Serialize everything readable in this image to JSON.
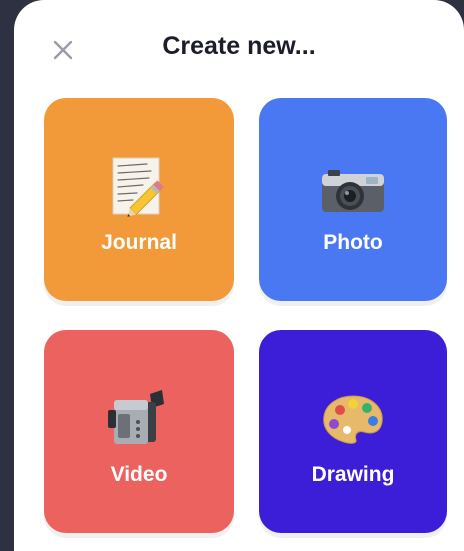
{
  "dialog": {
    "title": "Create new..."
  },
  "tiles": [
    {
      "label": "Journal",
      "icon": "memo-pencil-icon",
      "color": "#f2993a"
    },
    {
      "label": "Photo",
      "icon": "camera-icon",
      "color": "#4a78f2"
    },
    {
      "label": "Video",
      "icon": "video-camera-icon",
      "color": "#ec625e"
    },
    {
      "label": "Drawing",
      "icon": "artist-palette-icon",
      "color": "#3d1ed8"
    }
  ],
  "colors": {
    "backdrop": "#2e3142",
    "sheet": "#ffffff",
    "title_text": "#1c1d2b",
    "close_icon": "#9a9cab"
  }
}
